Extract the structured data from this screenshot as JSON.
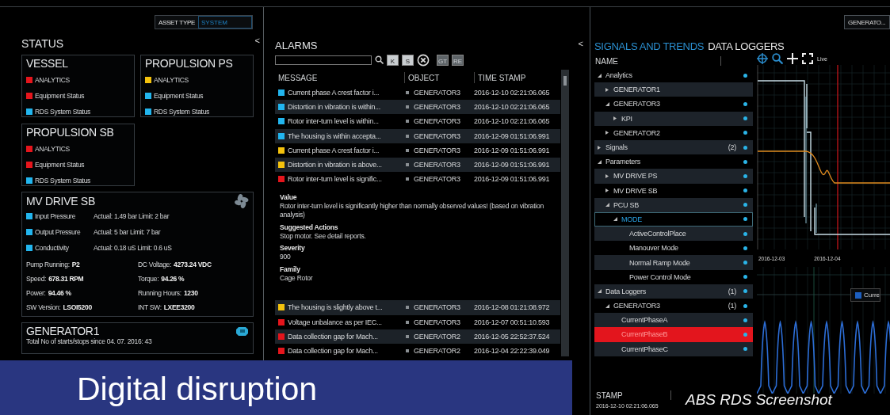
{
  "top_bar": {
    "asset_type_label": "ASSET TYPE",
    "asset_type_value": "SYSTEM",
    "object_field": "GENERATO..."
  },
  "status": {
    "title": "STATUS",
    "collapse": "<",
    "cards": [
      {
        "title": "VESSEL",
        "items": [
          {
            "label": "ANALYTICS",
            "color": "#e5151c"
          },
          {
            "label": "Equipment Status",
            "color": "#e5151c"
          },
          {
            "label": "RDS System Status",
            "color": "#22b5ee"
          }
        ]
      },
      {
        "title": "PROPULSION PS",
        "items": [
          {
            "label": "ANALYTICS",
            "color": "#f4c20d"
          },
          {
            "label": "Equipment Status",
            "color": "#22b5ee"
          },
          {
            "label": "RDS System Status",
            "color": "#22b5ee"
          }
        ]
      },
      {
        "title": "PROPULSION SB",
        "items": [
          {
            "label": "ANALYTICS",
            "color": "#e5151c"
          },
          {
            "label": "Equipment Status",
            "color": "#e5151c"
          },
          {
            "label": "RDS System Status",
            "color": "#22b5ee"
          }
        ]
      }
    ],
    "mv_drive": {
      "title": "MV DRIVE SB",
      "measurements": [
        {
          "label": "Input Pressure",
          "value": "Actual: 1.49 bar Limit: 2 bar",
          "color": "#22b5ee"
        },
        {
          "label": "Output Pressure",
          "value": "Actual: 5 bar Limit: 7 bar",
          "color": "#22b5ee"
        },
        {
          "label": "Conductivity",
          "value": "Actual: 0.18 uS Limit: 0.6 uS",
          "color": "#22b5ee"
        }
      ],
      "stats": [
        {
          "label": "Pump Running:",
          "value": "P2"
        },
        {
          "label": "DC Voltage:",
          "value": "4273.24 VDC"
        },
        {
          "label": "Speed:",
          "value": "678.31 RPM"
        },
        {
          "label": "Torque:",
          "value": "94.26 %"
        },
        {
          "label": "Power:",
          "value": "94.46 %"
        },
        {
          "label": "Running Hours:",
          "value": "1230"
        },
        {
          "label": "SW Version:",
          "value": "LSOI5200"
        },
        {
          "label": "INT SW:",
          "value": "LXEE3200"
        }
      ]
    },
    "generator": {
      "title": "GENERATOR1",
      "text": "Total No of starts/stops since 04. 07. 2016: 43"
    }
  },
  "alarms": {
    "title": "ALARMS",
    "collapse": "<",
    "toolbar": [
      {
        "kind": "search",
        "disabled": false
      },
      {
        "kind": "key",
        "label": "K",
        "disabled": false
      },
      {
        "kind": "key",
        "label": "S",
        "disabled": false
      },
      {
        "kind": "clear",
        "disabled": false
      },
      {
        "kind": "key",
        "label": "GT",
        "disabled": true
      },
      {
        "kind": "key",
        "label": "RE",
        "disabled": true
      }
    ],
    "columns": [
      "MESSAGE",
      "OBJECT",
      "TIME STAMP"
    ],
    "rows": [
      {
        "color": "#22b5ee",
        "message": "Current phase A crest factor i...",
        "object": "GENERATOR3",
        "time": "2016-12-10 02:21:06.065"
      },
      {
        "color": "#22b5ee",
        "message": "Distortion in vibration is within...",
        "object": "GENERATOR3",
        "time": "2016-12-10 02:21:06.065"
      },
      {
        "color": "#22b5ee",
        "message": "Rotor inter-turn level is within...",
        "object": "GENERATOR3",
        "time": "2016-12-10 02:21:06.065"
      },
      {
        "color": "#22b5ee",
        "message": "The housing is within accepta...",
        "object": "GENERATOR3",
        "time": "2016-12-09 01:51:06.991"
      },
      {
        "color": "#f4c20d",
        "message": "Current phase A crest factor i...",
        "object": "GENERATOR3",
        "time": "2016-12-09 01:51:06.991"
      },
      {
        "color": "#f4c20d",
        "message": "Distortion in vibration is above...",
        "object": "GENERATOR3",
        "time": "2016-12-09 01:51:06.991"
      },
      {
        "color": "#e5151c",
        "message": "Rotor inter-turn level is signific...",
        "object": "GENERATOR3",
        "time": "2016-12-09 01:51:06.991",
        "details": [
          {
            "label": "Value",
            "text": "Rotor inter-turn level is significantly higher than normally observed values! (based on vibration analysis)"
          },
          {
            "label": "Suggested Actions",
            "text": "Stop motor. See detail reports."
          },
          {
            "label": "Severity",
            "text": "900"
          },
          {
            "label": "Family",
            "text": "Cage Rotor"
          }
        ]
      },
      {
        "color": "#f4c20d",
        "message": "The housing is slightly above t...",
        "object": "GENERATOR3",
        "time": "2016-12-08 01:21:08.972"
      },
      {
        "color": "#e5151c",
        "message": "Voltage unbalance as per IEC...",
        "object": "GENERATOR3",
        "time": "2016-12-07 00:51:10.593"
      },
      {
        "color": "#e5151c",
        "message": "Data collection gap for Mach...",
        "object": "GENERATOR2",
        "time": "2016-12-05 22:52:37.524"
      },
      {
        "color": "#e5151c",
        "message": "Data collection gap for Mach...",
        "object": "GENERATOR2",
        "time": "2016-12-04 22:22:39.049"
      }
    ]
  },
  "trends": {
    "tabs": [
      {
        "label": "SIGNALS AND TRENDS",
        "selected": true
      },
      {
        "label": "DATA LOGGERS",
        "selected": false
      }
    ],
    "tree_header": "NAME",
    "live_label": "Live",
    "tree": [
      {
        "label": "Analytics",
        "expanded": true,
        "dot": true,
        "selected": false,
        "focused": false,
        "children": [
          {
            "label": "GENERATOR1",
            "expanded": false,
            "dot": false,
            "selected": false,
            "focused": false
          },
          {
            "label": "GENERATOR3",
            "expanded": true,
            "dot": true,
            "selected": false,
            "focused": false,
            "children": [
              {
                "label": "KPI",
                "expanded": false,
                "dot": true,
                "selected": false,
                "focused": false
              }
            ]
          },
          {
            "label": "GENERATOR2",
            "expanded": false,
            "dot": true,
            "selected": false,
            "focused": false
          }
        ]
      },
      {
        "label": "Signals",
        "count": "(2)",
        "expanded": false,
        "dot": true,
        "selected": false,
        "focused": false
      },
      {
        "label": "Parameters",
        "expanded": true,
        "dot": true,
        "selected": false,
        "focused": false,
        "children": [
          {
            "label": "MV DRIVE PS",
            "expanded": false,
            "dot": true,
            "selected": false,
            "focused": false
          },
          {
            "label": "MV DRIVE SB",
            "expanded": false,
            "dot": true,
            "selected": false,
            "focused": false
          },
          {
            "label": "PCU SB",
            "expanded": true,
            "dot": true,
            "selected": false,
            "focused": false,
            "children": [
              {
                "label": "MODE",
                "expanded": true,
                "dot": true,
                "selected": false,
                "focused": true,
                "children": [
                  {
                    "label": "ActiveControlPlace",
                    "dot": true,
                    "selected": false,
                    "focused": false
                  },
                  {
                    "label": "Manouver Mode",
                    "dot": true,
                    "selected": false,
                    "focused": false
                  },
                  {
                    "label": "Normal Ramp Mode",
                    "dot": true,
                    "selected": false,
                    "focused": false
                  },
                  {
                    "label": "Power Control Mode",
                    "dot": true,
                    "selected": false,
                    "focused": false
                  }
                ]
              }
            ]
          }
        ]
      },
      {
        "label": "Data Loggers",
        "count": "(1)",
        "expanded": true,
        "dot": true,
        "selected": false,
        "focused": false,
        "children": [
          {
            "label": "GENERATOR3",
            "count": "(1)",
            "expanded": true,
            "dot": true,
            "selected": false,
            "focused": false,
            "children": [
              {
                "label": "CurrentPhaseA",
                "dot": true,
                "selected": false,
                "focused": false
              },
              {
                "label": "CurrentPhaseB",
                "dot": true,
                "selected": true,
                "focused": false
              },
              {
                "label": "CurrentPhaseC",
                "dot": true,
                "selected": false,
                "focused": false
              }
            ]
          }
        ]
      }
    ],
    "trend_chart": {
      "x_labels": [
        "2016-12-03",
        "2016-12-04"
      ]
    },
    "wave_chart": {
      "legend": "Curre"
    },
    "stamp_header": "STAMP",
    "stamp_value": "2016-12-10 02:21:06.065"
  },
  "overlay": {
    "banner_title": "Digital disruption",
    "caption": "ABS RDS Screenshot"
  }
}
